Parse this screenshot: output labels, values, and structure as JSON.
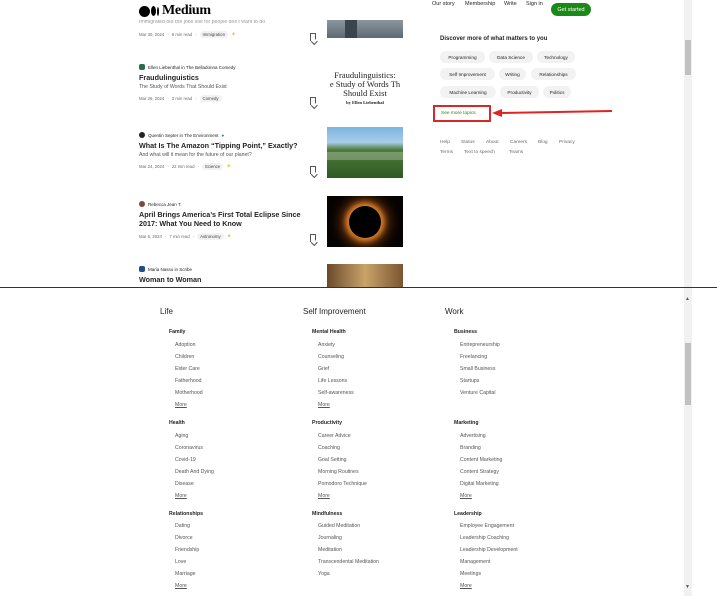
{
  "header": {
    "brand": "Medium",
    "nav": [
      "Our story",
      "Membership",
      "Write",
      "Sign in"
    ],
    "cta": "Get started"
  },
  "articles": [
    {
      "partial_title": "Immigrated but the jobs lost for people don't want to do",
      "date": "Mar 30, 2024",
      "read": "6 min read",
      "tag": "Immigration",
      "starred": true
    },
    {
      "author": "Ellen Liebenthal in The Belladonna Comedy",
      "title": "Fraudulinguistics",
      "subtitle": "The Study of Words That Should Exist",
      "date": "Mar 26, 2024",
      "read": "3 min read",
      "tag": "Comedy",
      "starred": false,
      "thumb_lines": [
        "Fraudulinguistics:",
        "e Study of Words Th",
        "Should Exist"
      ],
      "thumb_byline": "by Ellen Liebenthal"
    },
    {
      "author": "Quentin Septer in The Environment",
      "title": "What Is The Amazon “Tipping Point,” Exactly?",
      "subtitle": "And what will it mean for the future of our planet?",
      "date": "Mar 24, 2024",
      "read": "22 min read",
      "tag": "Science",
      "starred": true
    },
    {
      "author": "Rebecca Jean T.",
      "title": "April Brings America’s First Total Eclipse Since 2017: What You Need to Know",
      "date": "Mar 6, 2024",
      "read": "7 min read",
      "tag": "Astronomy",
      "starred": true
    },
    {
      "author": "Maria Nasso in Scribe",
      "title": "Woman to Woman"
    }
  ],
  "sidebar": {
    "title": "Discover more of what matters to you",
    "topics": [
      "Programming",
      "Data Science",
      "Technology",
      "Self Improvement",
      "Writing",
      "Relationships",
      "Machine Learning",
      "Productivity",
      "Politics"
    ],
    "see_more": "See more topics",
    "footer_links": [
      "Help",
      "Status",
      "About",
      "Careers",
      "Blog",
      "Privacy",
      "Terms",
      "Text to speech",
      "Teams"
    ]
  },
  "colors": {
    "accent_green": "#1a8917",
    "highlight_red": "#d62a2a"
  },
  "topics_page": {
    "columns": [
      {
        "title": "Life",
        "groups": [
          {
            "name": "Family",
            "items": [
              "Adoption",
              "Children",
              "Elder Care",
              "Fatherhood",
              "Motherhood"
            ],
            "more": "More"
          },
          {
            "name": "Health",
            "items": [
              "Aging",
              "Coronavirus",
              "Covid-19",
              "Death And Dying",
              "Disease"
            ],
            "more": "More"
          },
          {
            "name": "Relationships",
            "items": [
              "Dating",
              "Divorce",
              "Friendship",
              "Love",
              "Marriage"
            ],
            "more": "More"
          }
        ]
      },
      {
        "title": "Self Improvement",
        "groups": [
          {
            "name": "Mental Health",
            "items": [
              "Anxiety",
              "Counseling",
              "Grief",
              "Life Lessons",
              "Self-awareness"
            ],
            "more": "More"
          },
          {
            "name": "Productivity",
            "items": [
              "Career Advice",
              "Coaching",
              "Goal Setting",
              "Morning Routines",
              "Pomodoro Technique"
            ],
            "more": "More"
          },
          {
            "name": "Mindfulness",
            "items": [
              "Guided Meditation",
              "Journaling",
              "Meditation",
              "Transcendental Meditation",
              "Yoga"
            ],
            "more": ""
          }
        ]
      },
      {
        "title": "Work",
        "groups": [
          {
            "name": "Business",
            "items": [
              "Entrepreneurship",
              "Freelancing",
              "Small Business",
              "Startups",
              "Venture Capital"
            ],
            "more": ""
          },
          {
            "name": "Marketing",
            "items": [
              "Advertising",
              "Branding",
              "Content Marketing",
              "Content Strategy",
              "Digital Marketing"
            ],
            "more": "More"
          },
          {
            "name": "Leadership",
            "items": [
              "Employee Engagement",
              "Leadership Coaching",
              "Leadership Development",
              "Management",
              "Meetings"
            ],
            "more": "More"
          }
        ]
      }
    ]
  }
}
